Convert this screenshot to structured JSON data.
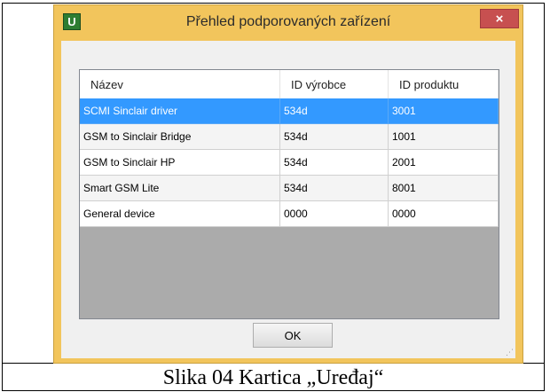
{
  "window": {
    "app_icon_letter": "U",
    "title": "Přehled podporovaných zařízení",
    "close_glyph": "×"
  },
  "table": {
    "columns": [
      "Název",
      "ID výrobce",
      "ID produktu"
    ],
    "rows": [
      [
        "SCMI Sinclair driver",
        "534d",
        "3001"
      ],
      [
        "GSM to Sinclair Bridge",
        "534d",
        "1001"
      ],
      [
        "GSM to Sinclair HP",
        "534d",
        "2001"
      ],
      [
        "Smart GSM Lite",
        "534d",
        "8001"
      ],
      [
        "General device",
        "0000",
        "0000"
      ]
    ],
    "selected_row": 0
  },
  "buttons": {
    "ok_label": "OK"
  },
  "caption": "Slika 04 Kartica „Uređaj“",
  "colors": {
    "title_bar": "#f2c55c",
    "close_button": "#c75050",
    "selection": "#3399ff",
    "grid_empty": "#ababab"
  },
  "icons": {
    "app": "app-logo-icon",
    "close": "close-icon",
    "grip": "resize-grip-icon"
  }
}
